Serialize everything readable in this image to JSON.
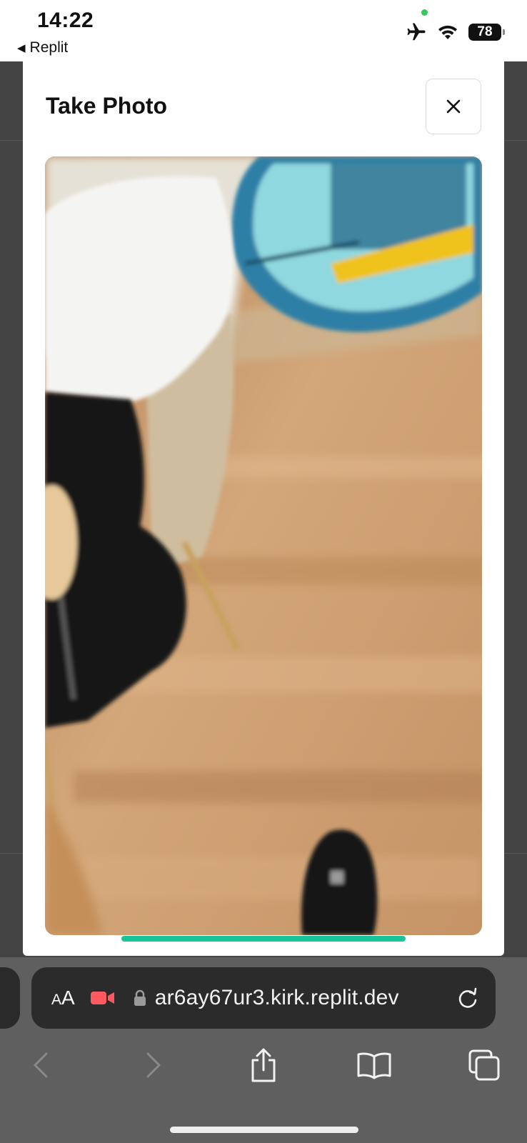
{
  "status_bar": {
    "time": "14:22",
    "back_app": "Replit",
    "battery": "78",
    "icons": [
      "airplane-mode-icon",
      "wifi-icon",
      "battery-icon"
    ],
    "camera_indicator_color": "#34c759"
  },
  "modal": {
    "title": "Take Photo",
    "close_icon": "close-icon",
    "capture_bar_color": "#19c39b"
  },
  "safari": {
    "text_size_label": "AA",
    "recording_icon": "video-camera-icon",
    "recording_color": "#ff5a5f",
    "secure_icon": "lock-icon",
    "url": "ar6ay67ur3.kirk.replit.dev",
    "reload_icon": "reload-icon",
    "toolbar": [
      "back-icon",
      "forward-icon",
      "share-icon",
      "bookmarks-icon",
      "tabs-icon"
    ]
  }
}
